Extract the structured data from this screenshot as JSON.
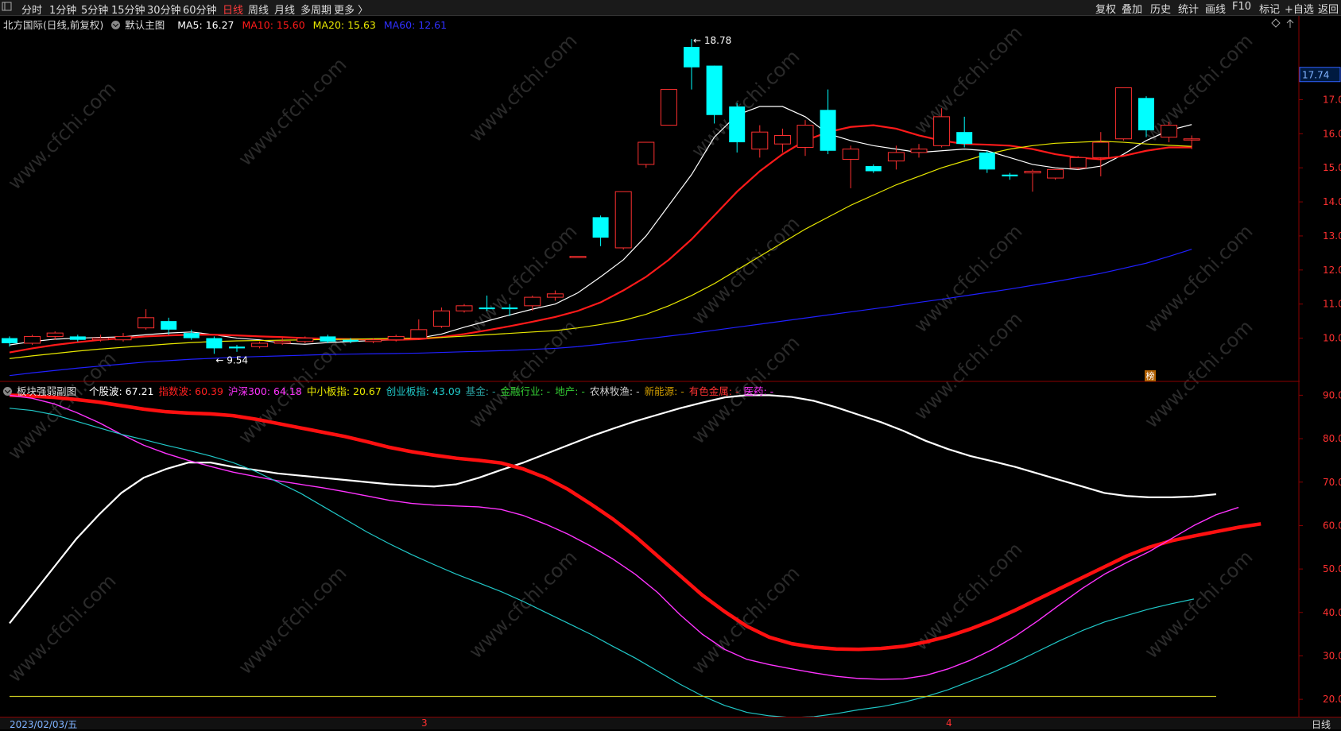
{
  "toolbar": {
    "corner_icon": "window-corner-icon",
    "periods": [
      "分时",
      "1分钟",
      "5分钟",
      "15分钟",
      "30分钟",
      "60分钟",
      "日线",
      "周线",
      "月线",
      "多周期",
      "更多 〉"
    ],
    "active_period": "日线",
    "right_items": [
      "复权",
      "叠加",
      "历史",
      "统计",
      "画线",
      "F10",
      "标记",
      "+自选",
      "返回"
    ]
  },
  "main_info": {
    "stock": "北方国际(日线,前复权)",
    "template": "默认主图",
    "ma5": "MA5: 16.27",
    "ma10": "MA10: 15.60",
    "ma20": "MA20: 15.63",
    "ma60": "MA60: 12.61",
    "diamond_icon": "diamond-icon",
    "up_arrow_icon": "up-arrow-icon"
  },
  "sub_info": {
    "title": "板块强弱副图",
    "items": [
      {
        "label": "个股波: 67.21",
        "color": "#ffffff"
      },
      {
        "label": "指数波: 60.39",
        "color": "#ff2020"
      },
      {
        "label": "沪深300: 64.18",
        "color": "#ff33ff"
      },
      {
        "label": "中小板指: 20.67",
        "color": "#e8e800"
      },
      {
        "label": "创业板指: 43.09",
        "color": "#20c8c8"
      },
      {
        "label": "基金: -",
        "color": "#2aa0a0"
      },
      {
        "label": "金融行业: -",
        "color": "#33cc33"
      },
      {
        "label": "地产: -",
        "color": "#33cc33"
      },
      {
        "label": "农林牧渔: -",
        "color": "#cccccc"
      },
      {
        "label": "新能源: -",
        "color": "#cc9900"
      },
      {
        "label": "有色金属: -",
        "color": "#ff3333"
      },
      {
        "label": "医药: -",
        "color": "#ff33ff"
      }
    ]
  },
  "annotations": {
    "high_label": "18.78",
    "low_label": "9.54",
    "current_price": "17.74",
    "badge": "榜"
  },
  "bottom": {
    "date": "2023/02/03/五",
    "month_marks": [
      "3",
      "4"
    ],
    "period_label": "日线"
  },
  "colors": {
    "up": "#ff3030",
    "down": "#00ffff",
    "ma5": "#ffffff",
    "ma10": "#ff1a1a",
    "ma20": "#e8e800",
    "ma60": "#2020ff",
    "grid_red": "#8b0000"
  },
  "chart_data": [
    {
      "type": "candlestick",
      "title": "北方国际(日线,前复权)",
      "y_ticks": [
        10.0,
        11.0,
        12.0,
        13.0,
        14.0,
        15.0,
        16.0,
        17.0
      ],
      "ylim": [
        8.8,
        18.9
      ],
      "candles": [
        {
          "o": 10.0,
          "c": 9.85,
          "h": 10.05,
          "l": 9.75
        },
        {
          "o": 9.85,
          "c": 10.05,
          "h": 10.1,
          "l": 9.8
        },
        {
          "o": 10.05,
          "c": 10.15,
          "h": 10.2,
          "l": 9.95
        },
        {
          "o": 10.05,
          "c": 9.95,
          "h": 10.1,
          "l": 9.9
        },
        {
          "o": 9.95,
          "c": 10.0,
          "h": 10.1,
          "l": 9.9
        },
        {
          "o": 9.95,
          "c": 10.05,
          "h": 10.15,
          "l": 9.9
        },
        {
          "o": 10.3,
          "c": 10.6,
          "h": 10.85,
          "l": 10.25
        },
        {
          "o": 10.5,
          "c": 10.25,
          "h": 10.6,
          "l": 10.1
        },
        {
          "o": 10.15,
          "c": 10.0,
          "h": 10.25,
          "l": 9.95
        },
        {
          "o": 10.0,
          "c": 9.7,
          "h": 10.05,
          "l": 9.54
        },
        {
          "o": 9.75,
          "c": 9.7,
          "h": 9.8,
          "l": 9.6
        },
        {
          "o": 9.75,
          "c": 9.85,
          "h": 9.9,
          "l": 9.7
        },
        {
          "o": 9.85,
          "c": 9.9,
          "h": 10.0,
          "l": 9.8
        },
        {
          "o": 9.9,
          "c": 10.0,
          "h": 10.05,
          "l": 9.85
        },
        {
          "o": 10.05,
          "c": 9.9,
          "h": 10.1,
          "l": 9.85
        },
        {
          "o": 9.95,
          "c": 9.9,
          "h": 10.0,
          "l": 9.85
        },
        {
          "o": 9.9,
          "c": 9.95,
          "h": 10.0,
          "l": 9.85
        },
        {
          "o": 9.95,
          "c": 10.05,
          "h": 10.1,
          "l": 9.9
        },
        {
          "o": 10.0,
          "c": 10.25,
          "h": 10.55,
          "l": 9.95
        },
        {
          "o": 10.35,
          "c": 10.8,
          "h": 10.9,
          "l": 10.3
        },
        {
          "o": 10.8,
          "c": 10.95,
          "h": 11.0,
          "l": 10.75
        },
        {
          "o": 10.9,
          "c": 10.85,
          "h": 11.25,
          "l": 10.8
        },
        {
          "o": 10.9,
          "c": 10.85,
          "h": 11.0,
          "l": 10.65
        },
        {
          "o": 10.95,
          "c": 11.2,
          "h": 11.25,
          "l": 10.8
        },
        {
          "o": 11.2,
          "c": 11.3,
          "h": 11.4,
          "l": 11.1
        },
        {
          "o": 12.4,
          "c": 12.4,
          "h": 12.4,
          "l": 12.4
        },
        {
          "o": 13.55,
          "c": 12.95,
          "h": 13.6,
          "l": 12.7
        },
        {
          "o": 12.65,
          "c": 14.3,
          "h": 14.3,
          "l": 12.6
        },
        {
          "o": 15.1,
          "c": 15.75,
          "h": 15.75,
          "l": 15.0
        },
        {
          "o": 16.25,
          "c": 17.3,
          "h": 17.3,
          "l": 16.25
        },
        {
          "o": 18.55,
          "c": 17.95,
          "h": 18.78,
          "l": 17.3
        },
        {
          "o": 18.0,
          "c": 16.55,
          "h": 18.0,
          "l": 16.3
        },
        {
          "o": 16.8,
          "c": 15.75,
          "h": 16.9,
          "l": 15.45
        },
        {
          "o": 15.55,
          "c": 16.05,
          "h": 16.25,
          "l": 15.3
        },
        {
          "o": 15.7,
          "c": 15.95,
          "h": 16.15,
          "l": 15.45
        },
        {
          "o": 15.6,
          "c": 16.25,
          "h": 16.4,
          "l": 15.35
        },
        {
          "o": 16.7,
          "c": 15.5,
          "h": 17.3,
          "l": 15.4
        },
        {
          "o": 15.25,
          "c": 15.55,
          "h": 15.65,
          "l": 14.4
        },
        {
          "o": 15.05,
          "c": 14.9,
          "h": 15.1,
          "l": 14.85
        },
        {
          "o": 15.2,
          "c": 15.45,
          "h": 15.65,
          "l": 14.95
        },
        {
          "o": 15.45,
          "c": 15.55,
          "h": 15.7,
          "l": 15.3
        },
        {
          "o": 15.65,
          "c": 16.5,
          "h": 16.75,
          "l": 15.6
        },
        {
          "o": 16.05,
          "c": 15.7,
          "h": 16.5,
          "l": 15.6
        },
        {
          "o": 15.45,
          "c": 14.95,
          "h": 15.5,
          "l": 14.85
        },
        {
          "o": 14.8,
          "c": 14.75,
          "h": 14.85,
          "l": 14.65
        },
        {
          "o": 14.85,
          "c": 14.9,
          "h": 14.95,
          "l": 14.3
        },
        {
          "o": 14.7,
          "c": 14.95,
          "h": 14.95,
          "l": 14.65
        },
        {
          "o": 15.0,
          "c": 15.3,
          "h": 15.35,
          "l": 14.95
        },
        {
          "o": 15.3,
          "c": 15.75,
          "h": 16.05,
          "l": 14.75
        },
        {
          "o": 15.85,
          "c": 17.35,
          "h": 17.35,
          "l": 15.8
        },
        {
          "o": 17.05,
          "c": 16.1,
          "h": 17.1,
          "l": 15.9
        },
        {
          "o": 15.9,
          "c": 16.25,
          "h": 16.35,
          "l": 15.75
        },
        {
          "o": 15.85,
          "c": 15.85,
          "h": 15.95,
          "l": 15.55
        }
      ],
      "series": [
        {
          "name": "MA5",
          "values": [
            9.8,
            9.9,
            9.97,
            10.0,
            10.02,
            10.04,
            10.1,
            10.15,
            10.18,
            10.1,
            10.0,
            9.95,
            9.85,
            9.82,
            9.87,
            9.9,
            9.93,
            9.95,
            10.0,
            10.12,
            10.32,
            10.5,
            10.68,
            10.85,
            11.0,
            11.33,
            11.8,
            12.3,
            13.0,
            13.9,
            14.8,
            15.9,
            16.55,
            16.8,
            16.8,
            16.5,
            16.0,
            15.8,
            15.65,
            15.55,
            15.45,
            15.5,
            15.55,
            15.5,
            15.3,
            15.1,
            15.0,
            14.95,
            15.05,
            15.4,
            15.8,
            16.1,
            16.27
          ]
        },
        {
          "name": "MA10",
          "values": [
            9.58,
            9.7,
            9.8,
            9.88,
            9.95,
            10.0,
            10.05,
            10.08,
            10.1,
            10.1,
            10.08,
            10.05,
            10.03,
            10.0,
            9.98,
            9.97,
            9.96,
            9.95,
            9.97,
            10.03,
            10.12,
            10.23,
            10.35,
            10.48,
            10.62,
            10.8,
            11.05,
            11.4,
            11.8,
            12.3,
            12.9,
            13.6,
            14.3,
            14.9,
            15.4,
            15.8,
            16.05,
            16.2,
            16.25,
            16.15,
            15.95,
            15.8,
            15.7,
            15.68,
            15.65,
            15.55,
            15.4,
            15.3,
            15.25,
            15.35,
            15.5,
            15.6,
            15.6
          ]
        },
        {
          "name": "MA20",
          "values": [
            9.4,
            9.48,
            9.55,
            9.62,
            9.68,
            9.73,
            9.78,
            9.83,
            9.87,
            9.9,
            9.92,
            9.93,
            9.94,
            9.95,
            9.96,
            9.97,
            9.98,
            9.99,
            10.0,
            10.02,
            10.06,
            10.1,
            10.14,
            10.18,
            10.22,
            10.3,
            10.4,
            10.52,
            10.7,
            10.95,
            11.25,
            11.6,
            12.0,
            12.4,
            12.8,
            13.2,
            13.55,
            13.9,
            14.2,
            14.5,
            14.75,
            15.0,
            15.2,
            15.4,
            15.55,
            15.65,
            15.72,
            15.75,
            15.78,
            15.75,
            15.7,
            15.66,
            15.63
          ]
        },
        {
          "name": "MA60",
          "values": [
            8.9,
            8.98,
            9.05,
            9.12,
            9.18,
            9.24,
            9.3,
            9.34,
            9.38,
            9.41,
            9.44,
            9.46,
            9.48,
            9.5,
            9.52,
            9.53,
            9.54,
            9.55,
            9.56,
            9.58,
            9.6,
            9.62,
            9.64,
            9.67,
            9.7,
            9.75,
            9.82,
            9.9,
            9.98,
            10.06,
            10.14,
            10.23,
            10.32,
            10.41,
            10.5,
            10.59,
            10.68,
            10.77,
            10.86,
            10.95,
            11.05,
            11.14,
            11.24,
            11.34,
            11.44,
            11.55,
            11.66,
            11.78,
            11.9,
            12.05,
            12.2,
            12.4,
            12.61
          ]
        }
      ]
    },
    {
      "type": "line",
      "title": "板块强弱副图",
      "y_ticks": [
        20.0,
        30.0,
        40.0,
        50.0,
        60.0,
        70.0,
        80.0,
        90.0
      ],
      "ylim": [
        16,
        93
      ],
      "series": [
        {
          "name": "个股波",
          "values": [
            37.5,
            44,
            50.5,
            57,
            62.5,
            67.5,
            71,
            73,
            74.5,
            74.5,
            73.5,
            72.8,
            72,
            71.5,
            71,
            70.5,
            70,
            69.5,
            69.2,
            69,
            69.5,
            71,
            72.8,
            74.5,
            76.5,
            78.5,
            80.5,
            82.3,
            84,
            85.5,
            87,
            88.3,
            89.5,
            90,
            90,
            89.6,
            88.7,
            87.2,
            85.5,
            83.8,
            81.8,
            79.5,
            77.6,
            76,
            74.8,
            73.5,
            72,
            70.5,
            69,
            67.5,
            66.8,
            66.5,
            66.5,
            66.7,
            67.21
          ]
        },
        {
          "name": "指数波",
          "values": [
            90,
            89.8,
            89.5,
            89,
            88.4,
            87.6,
            86.8,
            86.2,
            85.9,
            85.7,
            85.3,
            84.5,
            83.5,
            82.5,
            81.5,
            80.5,
            79.3,
            78,
            77,
            76.2,
            75.5,
            75,
            74.4,
            73,
            71,
            68.3,
            65,
            61.5,
            57.5,
            53,
            48.5,
            44,
            40.2,
            36.8,
            34.3,
            32.8,
            32,
            31.6,
            31.5,
            31.7,
            32.2,
            33.2,
            34.5,
            36.2,
            38.2,
            40.5,
            43,
            45.5,
            48,
            50.5,
            53,
            55,
            56.5,
            57.6,
            58.6,
            59.6,
            60.39
          ]
        },
        {
          "name": "沪深300",
          "values": [
            90,
            89.3,
            88,
            86,
            83.7,
            81,
            78.5,
            76.6,
            75,
            73.6,
            72.3,
            71.3,
            70.3,
            69.5,
            68.7,
            67.8,
            66.8,
            65.8,
            65.1,
            64.7,
            64.5,
            64.3,
            63.7,
            62.3,
            60.3,
            58,
            55.3,
            52.3,
            48.8,
            44.6,
            39.5,
            35,
            31.5,
            29.2,
            28,
            27,
            26.1,
            25.3,
            24.8,
            24.6,
            24.7,
            25.5,
            27,
            29,
            31.5,
            34.5,
            38,
            41.8,
            45.5,
            48.8,
            51.5,
            54,
            57,
            60,
            62.5,
            64.18
          ]
        },
        {
          "name": "创业板指",
          "values": [
            87,
            86.5,
            85.5,
            84,
            82.5,
            81,
            79.8,
            78.5,
            77.3,
            76,
            74.5,
            72.5,
            70,
            67.5,
            64.5,
            61.5,
            58.5,
            55.8,
            53.3,
            51,
            48.8,
            46.8,
            44.8,
            42.5,
            40,
            37.5,
            35,
            32.2,
            29.5,
            26.5,
            23.5,
            20.8,
            18.6,
            17,
            16.2,
            15.8,
            16,
            16.7,
            17.6,
            18.3,
            19.3,
            20.6,
            22.2,
            24.2,
            26.2,
            28.5,
            31,
            33.5,
            35.8,
            37.8,
            39.3,
            40.8,
            42,
            43.09
          ]
        },
        {
          "name": "中小板指",
          "values": [
            20.67,
            20.67,
            20.67,
            20.67,
            20.67,
            20.67,
            20.67,
            20.67,
            20.67,
            20.67,
            20.67,
            20.67,
            20.67,
            20.67,
            20.67,
            20.67,
            20.67,
            20.67,
            20.67,
            20.67,
            20.67,
            20.67,
            20.67,
            20.67,
            20.67,
            20.67,
            20.67,
            20.67,
            20.67,
            20.67,
            20.67,
            20.67,
            20.67,
            20.67,
            20.67,
            20.67,
            20.67,
            20.67,
            20.67,
            20.67,
            20.67,
            20.67,
            20.67,
            20.67,
            20.67,
            20.67,
            20.67,
            20.67,
            20.67,
            20.67,
            20.67,
            20.67,
            20.67,
            20.67,
            20.67
          ]
        }
      ]
    }
  ]
}
